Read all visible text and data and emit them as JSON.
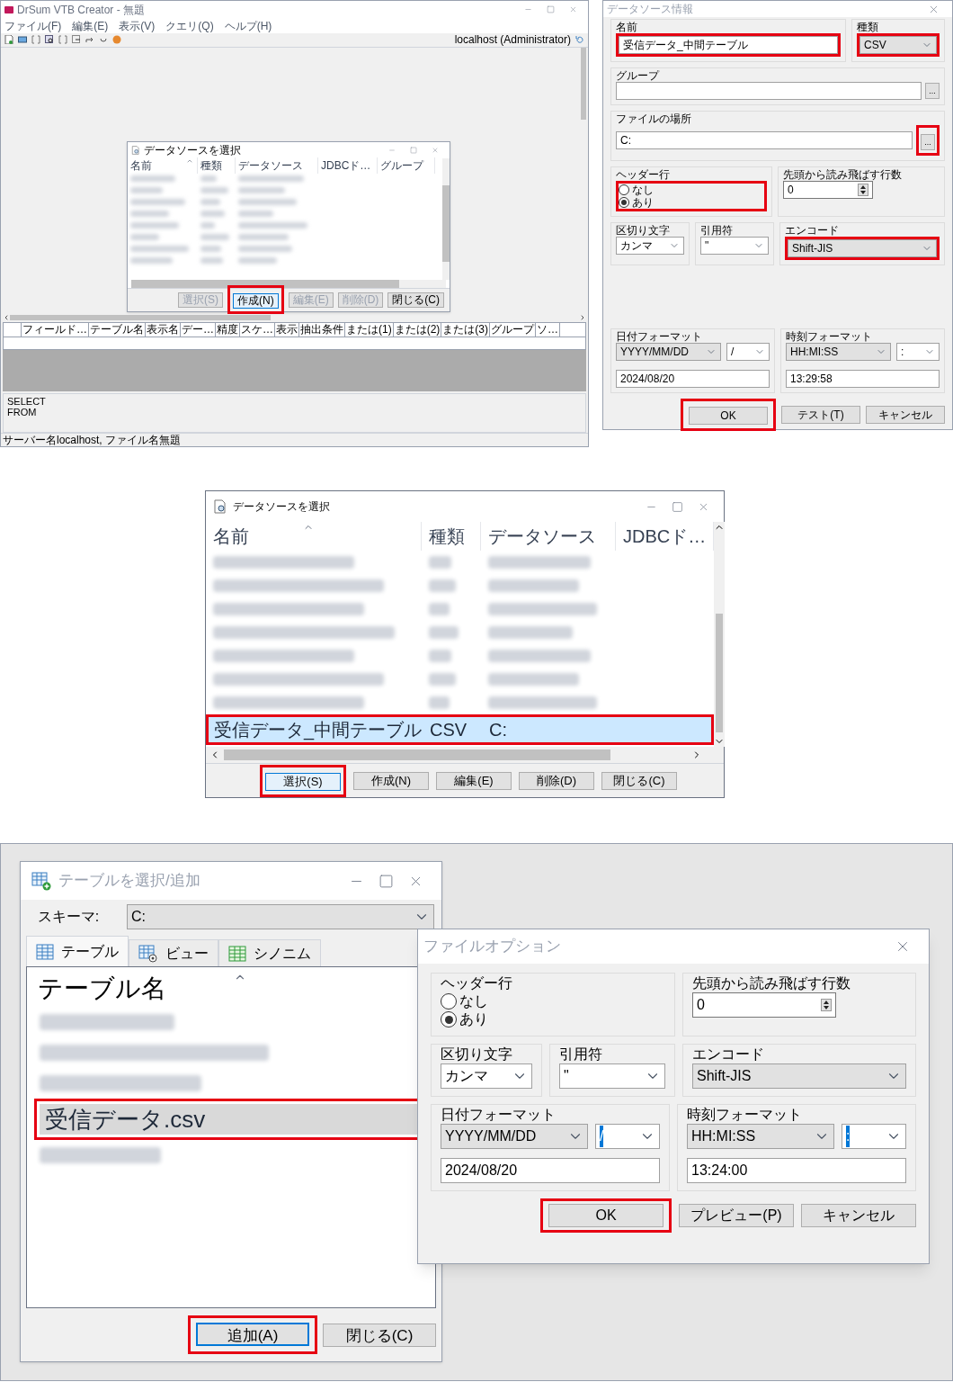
{
  "app_window": {
    "title": "DrSum VTB Creator - 無題",
    "menu": [
      "ファイル(F)",
      "編集(E)",
      "表示(V)",
      "クエリ(Q)",
      "ヘルプ(H)"
    ],
    "connection": "localhost (Administrator)",
    "datasource_dialog": {
      "title": "データソースを選択",
      "columns": [
        {
          "label": "名前",
          "sorted": true
        },
        {
          "label": "種類",
          "sorted": false
        },
        {
          "label": "データソース",
          "sorted": false
        },
        {
          "label": "JDBCド…",
          "sorted": false
        },
        {
          "label": "グループ",
          "sorted": false
        }
      ],
      "rows": [
        {
          "kind": "blurred",
          "selected": false
        },
        {
          "kind": "blurred",
          "selected": false
        },
        {
          "kind": "blurred",
          "selected": false
        },
        {
          "kind": "blurred",
          "selected": false
        },
        {
          "kind": "blurred",
          "selected": false
        },
        {
          "kind": "blurred",
          "selected": false
        },
        {
          "kind": "blurred",
          "selected": false
        },
        {
          "kind": "blurred",
          "selected": false
        }
      ],
      "buttons": [
        {
          "label": "選択(S)",
          "disabled": true,
          "focused": false,
          "highlighted": false
        },
        {
          "label": "作成(N)",
          "disabled": false,
          "focused": true,
          "highlighted": true
        },
        {
          "label": "編集(E)",
          "disabled": true,
          "focused": false,
          "highlighted": false
        },
        {
          "label": "削除(D)",
          "disabled": true,
          "focused": false,
          "highlighted": false
        },
        {
          "label": "閉じる(C)",
          "disabled": false,
          "focused": false,
          "highlighted": false
        }
      ]
    },
    "grid_columns": [
      "フィールド…",
      "テーブル名",
      "表示名",
      "デー…",
      "精度",
      "スケ…",
      "表示",
      "抽出条件",
      "または(1)",
      "または(2)",
      "または(3)",
      "グループ",
      "ソ…"
    ],
    "sql_lines": [
      "SELECT",
      "FROM"
    ],
    "status_bar": "サーバー名localhost, ファイル名無題"
  },
  "datasource_info": {
    "title": "データソース情報",
    "name": {
      "label": "名前",
      "value": "受信データ_中間テーブル",
      "highlighted": true
    },
    "type": {
      "label": "種類",
      "value": "CSV",
      "highlighted": true
    },
    "group": {
      "label": "グループ",
      "browse": "...",
      "highlighted": false
    },
    "location": {
      "label": "ファイルの場所",
      "value": "C:",
      "browse": "...",
      "highlighted": true
    },
    "options": {
      "header_row": {
        "label": "ヘッダー行",
        "highlighted": true,
        "options": [
          {
            "label": "なし",
            "selected": false
          },
          {
            "label": "あり",
            "selected": true
          }
        ]
      },
      "skip_rows": {
        "label": "先頭から読み飛ばす行数",
        "value": "0"
      },
      "delimiter": {
        "label": "区切り文字",
        "value": "カンマ"
      },
      "quote": {
        "label": "引用符",
        "value": "\""
      },
      "encoding": {
        "label": "エンコード",
        "value": "Shift-JIS",
        "highlighted": true
      },
      "date_format": {
        "label": "日付フォーマット",
        "format": "YYYY/MM/DD",
        "separator": "/",
        "separator_selected": false,
        "sample": "2024/08/20"
      },
      "time_format": {
        "label": "時刻フォーマット",
        "format": "HH:MI:SS",
        "separator": ":",
        "separator_selected": false,
        "sample": "13:29:58"
      },
      "buttons": [
        {
          "label": "OK",
          "highlighted": true
        },
        {
          "label": "テスト(T)",
          "highlighted": false
        },
        {
          "label": "キャンセル",
          "highlighted": false
        }
      ]
    }
  },
  "datasource_select": {
    "title": "データソースを選択",
    "columns": [
      {
        "label": "名前",
        "sorted": true
      },
      {
        "label": "種類",
        "sorted": false
      },
      {
        "label": "データソース",
        "sorted": false
      },
      {
        "label": "JDBCド…",
        "sorted": false
      }
    ],
    "rows": [
      {
        "kind": "blurred",
        "selected": false
      },
      {
        "kind": "blurred",
        "selected": false
      },
      {
        "kind": "blurred",
        "selected": false
      },
      {
        "kind": "blurred",
        "selected": false
      },
      {
        "kind": "blurred",
        "selected": false
      },
      {
        "kind": "blurred",
        "selected": false
      },
      {
        "kind": "blurred",
        "selected": false
      },
      {
        "kind": "entry",
        "cells": [
          "受信データ_中間テーブル",
          "CSV",
          "C:"
        ],
        "selected": true,
        "highlighted": true
      }
    ],
    "buttons": [
      {
        "label": "選択(S)",
        "disabled": false,
        "focused": true,
        "highlighted": true
      },
      {
        "label": "作成(N)",
        "disabled": false,
        "focused": false,
        "highlighted": false
      },
      {
        "label": "編集(E)",
        "disabled": false,
        "focused": false,
        "highlighted": false
      },
      {
        "label": "削除(D)",
        "disabled": false,
        "focused": false,
        "highlighted": false
      },
      {
        "label": "閉じる(C)",
        "disabled": false,
        "focused": false,
        "highlighted": false
      }
    ]
  },
  "table_dialog": {
    "title": "テーブルを選択/追加",
    "schema": {
      "label": "スキーマ:",
      "value": "C:"
    },
    "tabs": [
      {
        "kind": "table",
        "label": "テーブル",
        "selected": true
      },
      {
        "kind": "view",
        "label": "ビュー",
        "selected": false
      },
      {
        "kind": "synonym",
        "label": "シノニム",
        "selected": false
      }
    ],
    "list": {
      "header": "テーブル名",
      "sorted": true,
      "rows": [
        {
          "kind": "blurred",
          "selected": false
        },
        {
          "kind": "blurred",
          "selected": false
        },
        {
          "kind": "blurred",
          "selected": false
        },
        {
          "kind": "entry",
          "label": "受信データ.csv",
          "selected": true,
          "highlighted": true
        },
        {
          "kind": "blurred",
          "selected": false
        }
      ]
    },
    "buttons": [
      {
        "label": "追加(A)",
        "focused": true,
        "highlighted": true
      },
      {
        "label": "閉じる(C)",
        "focused": false,
        "highlighted": false
      }
    ]
  },
  "file_options": {
    "title": "ファイルオプション",
    "options": {
      "header_row": {
        "label": "ヘッダー行",
        "highlighted": false,
        "options": [
          {
            "label": "なし",
            "selected": false
          },
          {
            "label": "あり",
            "selected": true
          }
        ]
      },
      "skip_rows": {
        "label": "先頭から読み飛ばす行数",
        "value": "0"
      },
      "delimiter": {
        "label": "区切り文字",
        "value": "カンマ"
      },
      "quote": {
        "label": "引用符",
        "value": "\""
      },
      "encoding": {
        "label": "エンコード",
        "value": "Shift-JIS",
        "highlighted": false
      },
      "date_format": {
        "label": "日付フォーマット",
        "format": "YYYY/MM/DD",
        "separator": "/",
        "separator_selected": true,
        "sample": "2024/08/20"
      },
      "time_format": {
        "label": "時刻フォーマット",
        "format": "HH:MI:SS",
        "separator": ":",
        "separator_selected": true,
        "sample": "13:24:00"
      },
      "buttons": [
        {
          "label": "OK",
          "highlighted": true
        },
        {
          "label": "プレビュー(P)",
          "highlighted": false
        },
        {
          "label": "キャンセル",
          "highlighted": false
        }
      ]
    }
  }
}
